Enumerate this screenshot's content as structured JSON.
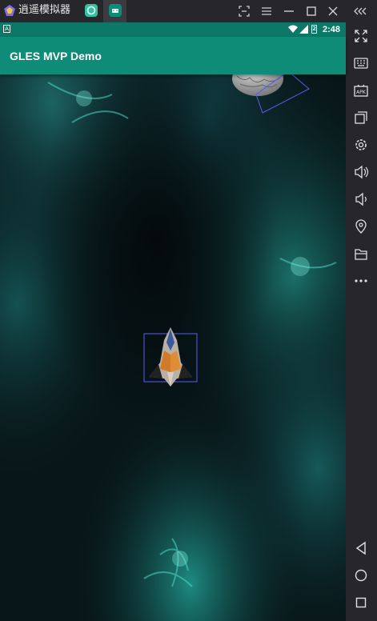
{
  "window": {
    "title": "逍遥模拟器",
    "tabs": [
      {
        "icon": "chat-bubble-app-icon",
        "color": "#2ec5a0"
      },
      {
        "icon": "android-app-icon",
        "color": "#0f8c77",
        "active": true
      }
    ],
    "controls": [
      "screen-capture-icon",
      "menu-icon",
      "minimize-icon",
      "maximize-icon",
      "close-icon",
      "collapse-sidebar-icon"
    ]
  },
  "status_bar": {
    "left_icon": "A",
    "time": "2:48",
    "battery_level": "2",
    "background_color": "#0d7867"
  },
  "app_bar": {
    "title": "GLES MVP Demo",
    "background_color": "#0f8c77"
  },
  "scene": {
    "background": "space nebula",
    "objects": [
      "asteroid",
      "spaceship"
    ],
    "bounding_box_color": "#5a5cf0"
  },
  "side_toolbar": {
    "buttons": [
      "fullscreen-icon",
      "keyboard-icon",
      "apk-install-icon",
      "multi-window-icon",
      "settings-icon",
      "volume-up-icon",
      "volume-down-icon",
      "location-icon",
      "folder-icon",
      "more-icon"
    ],
    "nav": [
      "back-icon",
      "home-icon",
      "recents-icon"
    ]
  }
}
